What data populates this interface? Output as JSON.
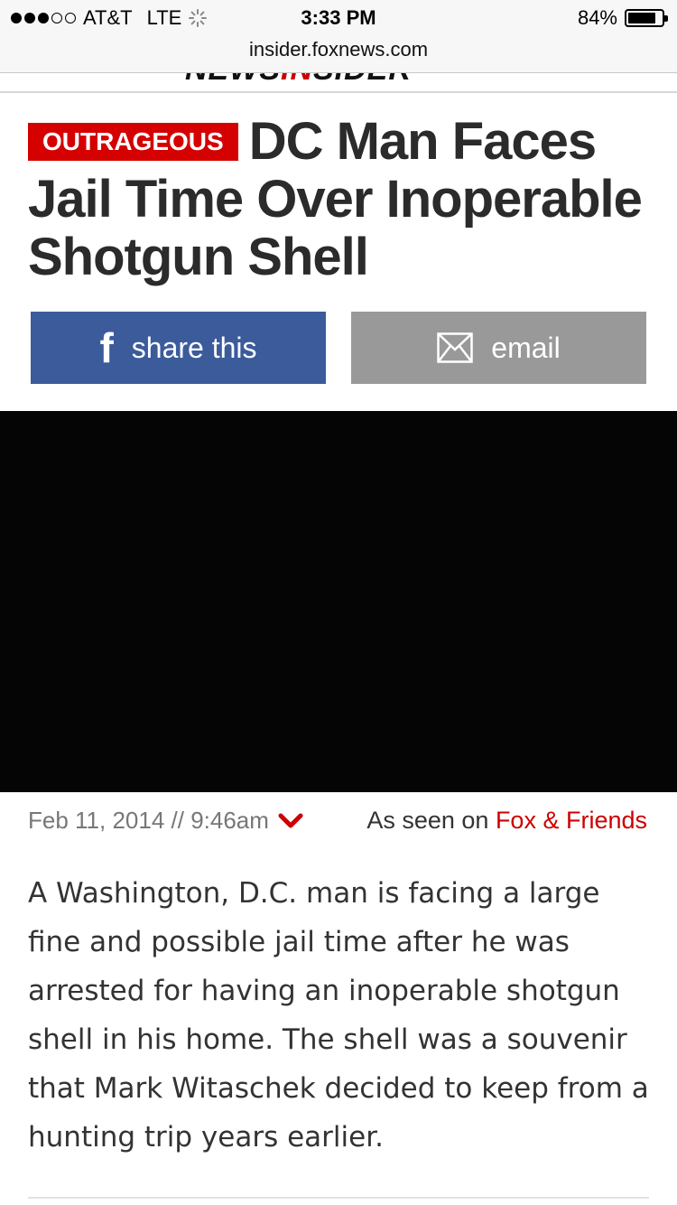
{
  "status_bar": {
    "carrier": "AT&T",
    "network": "LTE",
    "time": "3:33 PM",
    "battery_percent": "84%",
    "battery_level": 0.84,
    "signal_bars_filled": 3,
    "signal_bars_total": 5
  },
  "browser": {
    "url": "insider.foxnews.com"
  },
  "site": {
    "logo_text_black": "NEWS",
    "logo_text_red": "IN",
    "logo_text_rest": "SIDER"
  },
  "article": {
    "badge": "OUTRAGEOUS",
    "title": "DC Man Faces Jail Time Over Inoperable Shotgun Shell",
    "share_facebook_label": "share this",
    "share_email_label": "email",
    "date": "Feb 11, 2014 // 9:46am",
    "seen_prefix": "As seen on",
    "seen_show": "Fox & Friends",
    "body": "A Washington, D.C. man is facing a large fine and possible jail time after he was arrested for having an inoperable shotgun shell in his home. The shell was a souvenir that Mark Witaschek decided to keep from a hunting trip years earlier."
  },
  "colors": {
    "badge_red": "#d50000",
    "facebook_blue": "#3b5b9b",
    "email_gray": "#999999",
    "link_red": "#cc0000"
  },
  "icons": [
    "facebook-icon",
    "envelope-icon",
    "chevron-down-icon",
    "loading-spinner-icon",
    "battery-icon"
  ]
}
